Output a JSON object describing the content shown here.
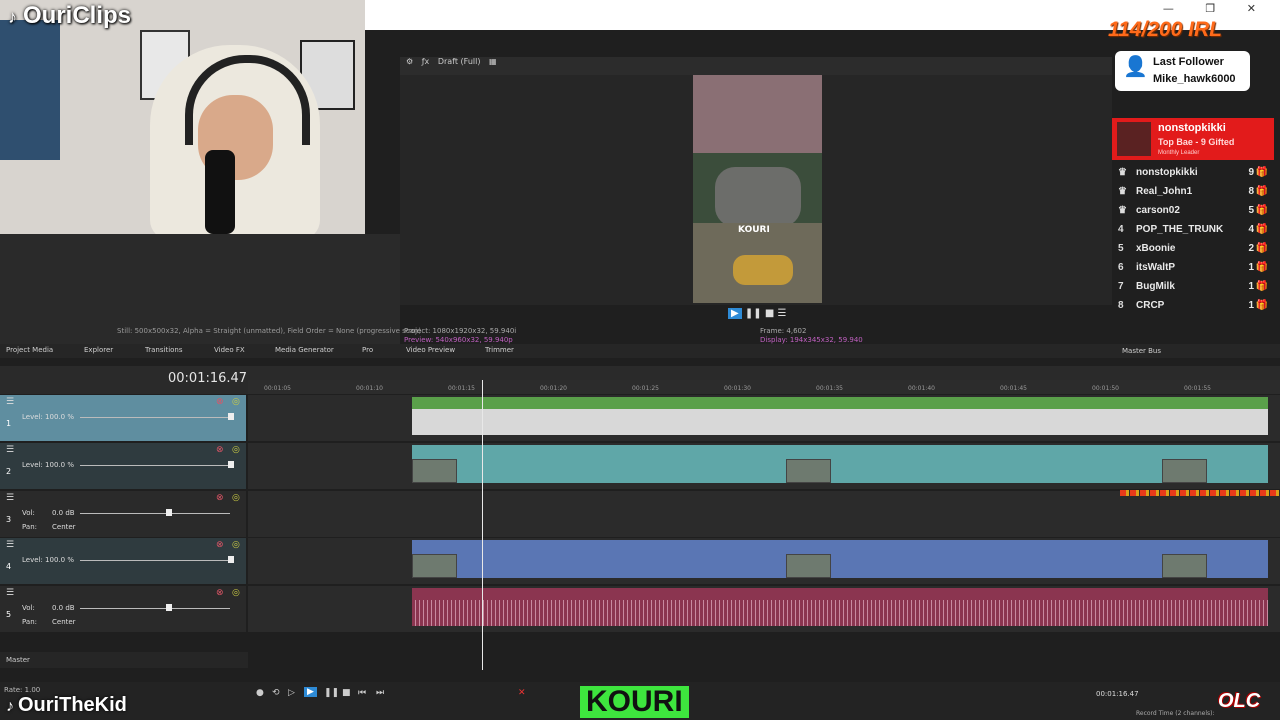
{
  "overlay": {
    "brand_top": "OuriClips",
    "brand_bottom": "OuriTheKid",
    "counter": "114/200 IRL",
    "last_follower_title": "Last Follower",
    "last_follower_name": "Mike_hawk6000",
    "leader": {
      "name": "nonstopkikki",
      "sub": "Top Bae - 9 Gifted",
      "tag": "Monthly Leader"
    },
    "leaderboard": [
      {
        "rank": "",
        "user": "nonstopkikki",
        "count": "9"
      },
      {
        "rank": "",
        "user": "Real_John1",
        "count": "8"
      },
      {
        "rank": "",
        "user": "carson02",
        "count": "5"
      },
      {
        "rank": "4",
        "user": "POP_THE_TRUNK",
        "count": "4"
      },
      {
        "rank": "5",
        "user": "xBoonie",
        "count": "2"
      },
      {
        "rank": "6",
        "user": "itsWaltP",
        "count": "1"
      },
      {
        "rank": "7",
        "user": "BugMilk",
        "count": "1"
      },
      {
        "rank": "8",
        "user": "CRCP",
        "count": "1"
      }
    ],
    "kouri_logo": "KOURI",
    "olc_logo": "OLC"
  },
  "editor": {
    "still_info": "Still: 500x500x32, Alpha = Straight (unmatted), Field Order = None (progressive scan)",
    "preview_mode": "Draft (Full)",
    "project_info": "Project: 1080x1920x32, 59.940i",
    "preview_info": "Preview: 540x960x32, 59.940p",
    "frame_label": "Frame: 4,602",
    "display_label": "Display: 194x345x32, 59.940",
    "tabs": [
      "Project Media",
      "Explorer",
      "Transitions",
      "Video FX",
      "Media Generator",
      "Pro",
      "Video Preview",
      "Trimmer"
    ],
    "master_bus": "Master Bus",
    "timecode": "00:01:16.47",
    "ruler_ticks": [
      "00:01:05",
      "00:01:10",
      "00:01:15",
      "00:01:20",
      "00:01:25",
      "00:01:30",
      "00:01:35",
      "00:01:40",
      "00:01:45",
      "00:01:50",
      "00:01:55"
    ],
    "tracks": [
      {
        "num": "1",
        "label": "Level: 100.0 %"
      },
      {
        "num": "2",
        "label": "Level: 100.0 %"
      },
      {
        "num": "3",
        "label": "Vol:",
        "value": "0.0 dB",
        "pan_label": "Pan:",
        "pan_value": "Center"
      },
      {
        "num": "4",
        "label": "Level: 100.0 %"
      },
      {
        "num": "5",
        "label": "Vol:",
        "value": "0.0 dB",
        "pan_label": "Pan:",
        "pan_value": "Center"
      }
    ],
    "master_label": "Master",
    "rate": "Rate: 1.00",
    "bottom_timecode": "00:01:16.47",
    "record_time": "Record Time (2 channels):"
  }
}
